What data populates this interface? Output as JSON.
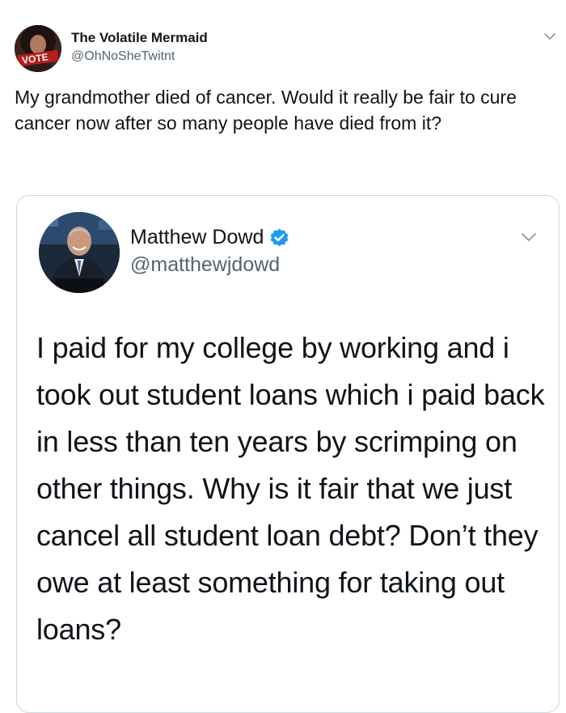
{
  "outer_tweet": {
    "display_name": "The Volatile Mermaid",
    "handle": "@OhNoSheTwitnt",
    "avatar_text": "VOTE",
    "text": "My grandmother died of cancer. Would it really be fair to cure cancer now after so many people have died from it?"
  },
  "quoted_tweet": {
    "display_name": "Matthew Dowd",
    "handle": "@matthewjdowd",
    "text": "I paid for my college by working and i took out student loans which i paid back in less than ten years by scrimping on other things.  Why is it fair that we just cancel all student loan debt? Don’t they owe at least something for taking out loans?"
  },
  "icons": {
    "outer_menu": "chevron-down-icon",
    "inner_menu": "chevron-down-icon",
    "verified": "verified-badge-icon"
  },
  "colors": {
    "verified": "#1d9bf0",
    "secondary_text": "#536471",
    "border": "#cfd9de"
  }
}
